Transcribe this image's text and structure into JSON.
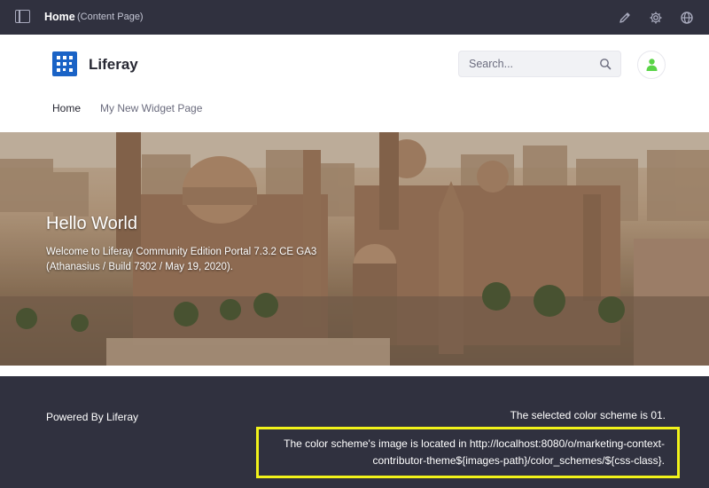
{
  "control_menu": {
    "title": "Home",
    "subtitle": "(Content Page)",
    "icons": [
      "sidebar-toggle-icon",
      "pencil-icon",
      "gear-icon",
      "globe-icon"
    ]
  },
  "header": {
    "site_name": "Liferay",
    "search_placeholder": "Search...",
    "nav": [
      {
        "label": "Home"
      },
      {
        "label": "My New Widget Page"
      }
    ],
    "colors": {
      "logo": "#1a63c6",
      "avatar": "#5ad447"
    }
  },
  "hero": {
    "title": "Hello World",
    "text": "Welcome to Liferay Community Edition Portal 7.3.2 CE GA3 (Athanasius / Build 7302 / May 19, 2020)."
  },
  "footer": {
    "powered_by": "Powered By Liferay",
    "scheme_text": "The selected color scheme is 01.",
    "scheme_path": "The color scheme's image is located in http://localhost:8080/o/marketing-context-contributor-theme${images-path}/color_schemes/${css-class}.",
    "highlight_color": "#f2f31a"
  }
}
